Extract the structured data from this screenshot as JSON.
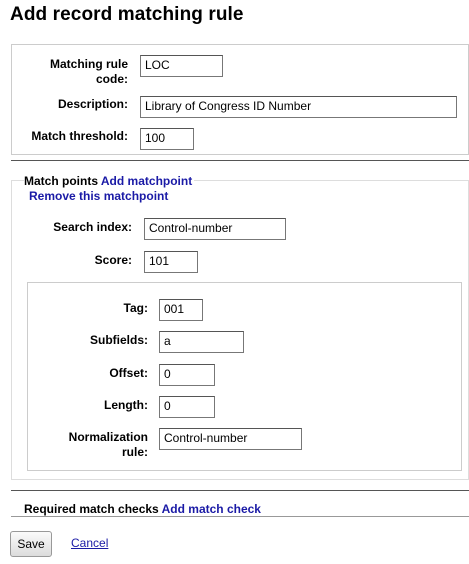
{
  "page": {
    "title": "Add record matching rule"
  },
  "rule": {
    "code_label": "Matching rule code:",
    "code_value": "LOC",
    "description_label": "Description:",
    "description_value": "Library of Congress ID Number",
    "threshold_label": "Match threshold:",
    "threshold_value": "100"
  },
  "match_points": {
    "legend": "Match points",
    "add_link": "Add matchpoint",
    "remove_link": "Remove this matchpoint",
    "search_index_label": "Search index:",
    "search_index_value": "Control-number",
    "score_label": "Score:",
    "score_value": "101",
    "component": {
      "tag_label": "Tag:",
      "tag_value": "001",
      "subfields_label": "Subfields:",
      "subfields_value": "a",
      "offset_label": "Offset:",
      "offset_value": "0",
      "length_label": "Length:",
      "length_value": "0",
      "normalization_label": "Normalization rule:",
      "normalization_value": "Control-number"
    }
  },
  "match_checks": {
    "legend": "Required match checks",
    "add_link": "Add match check"
  },
  "actions": {
    "save_label": "Save",
    "cancel_label": "Cancel"
  }
}
